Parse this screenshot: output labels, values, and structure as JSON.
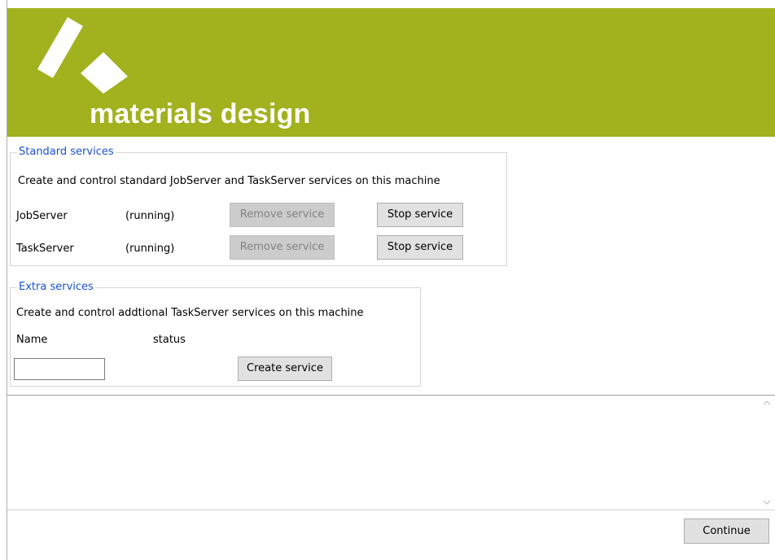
{
  "brand": {
    "name": "materials design"
  },
  "colors": {
    "banner": "#a2b11e",
    "legend": "#1a52d6"
  },
  "standard_services": {
    "title": "Standard services",
    "description": "Create and control standard JobServer and TaskServer services on this machine",
    "rows": [
      {
        "name": "JobServer",
        "status": "(running)",
        "remove_label": "Remove service",
        "stop_label": "Stop service"
      },
      {
        "name": "TaskServer",
        "status": "(running)",
        "remove_label": "Remove service",
        "stop_label": "Stop service"
      }
    ]
  },
  "extra_services": {
    "title": "Extra services",
    "description": "Create and control addtional TaskServer services on this machine",
    "name_header": "Name",
    "status_header": "status",
    "name_value": "",
    "create_label": "Create service"
  },
  "log": {
    "text": ""
  },
  "footer": {
    "continue_label": "Continue"
  },
  "icons": {
    "scroll_up": "chevron-up-icon",
    "scroll_down": "chevron-down-icon"
  }
}
